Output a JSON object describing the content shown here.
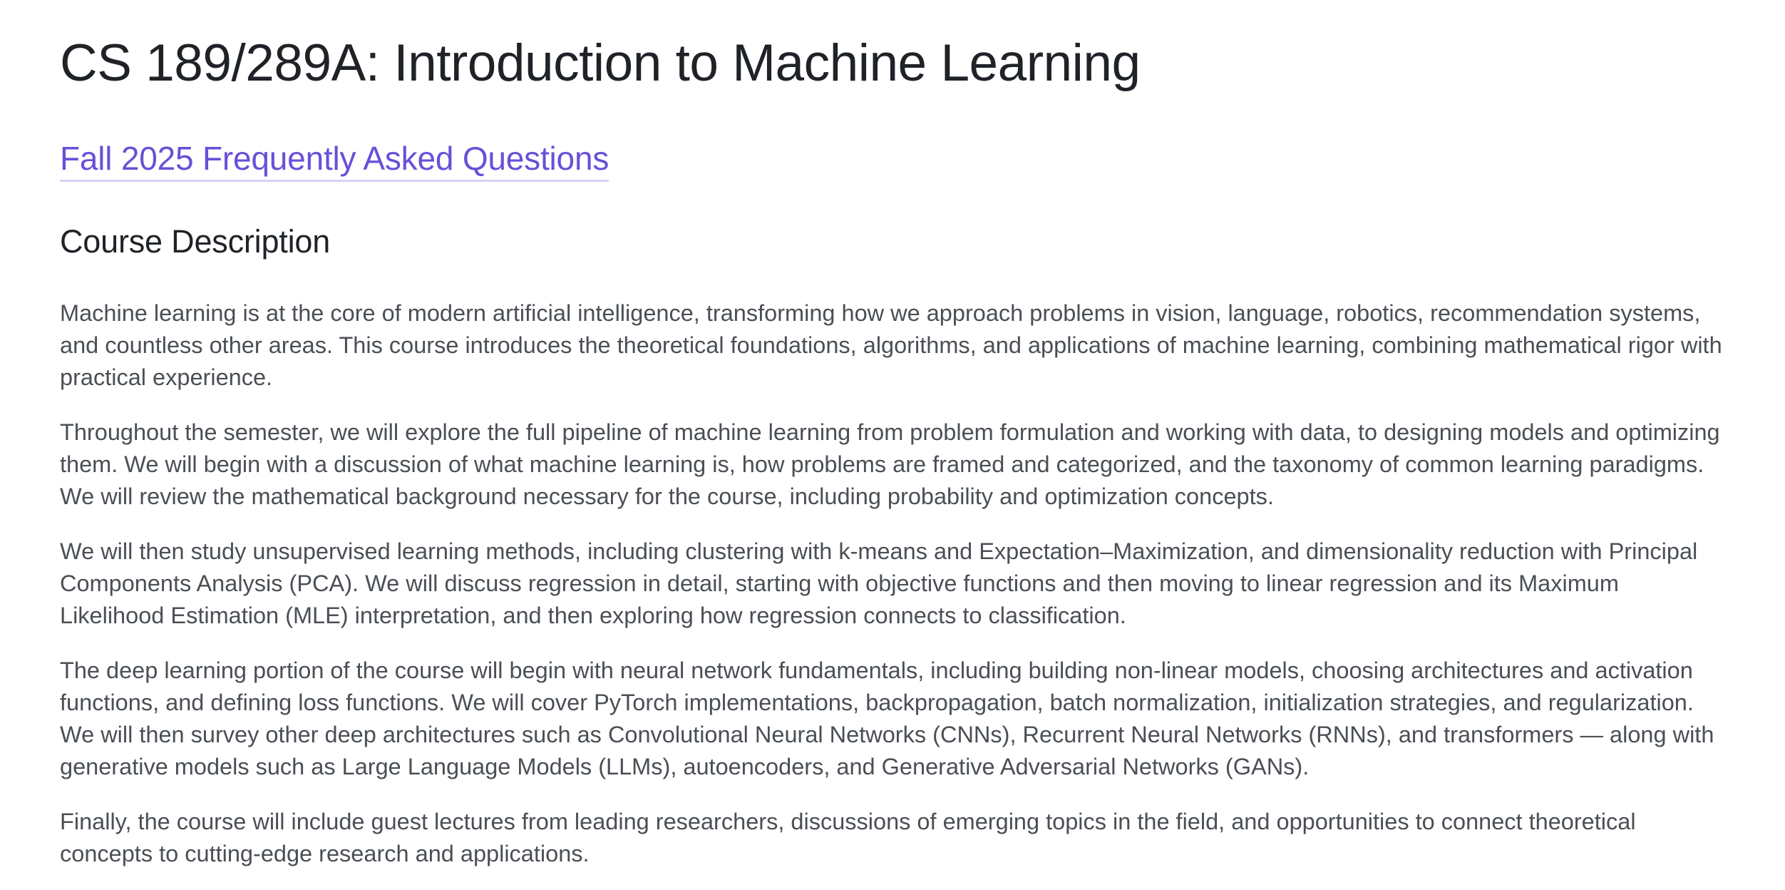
{
  "page": {
    "title": "CS 189/289A: Introduction to Machine Learning",
    "faq_link": "Fall 2025 Frequently Asked Questions",
    "section_heading": "Course Description",
    "colors": {
      "link": "#6a4fd8",
      "heading": "#1f2328",
      "body_text": "#4a4f55"
    },
    "paragraphs": [
      "Machine learning is at the core of modern artificial intelligence, transforming how we approach problems in vision, language, robotics, recommendation systems, and countless other areas. This course introduces the theoretical foundations, algorithms, and applications of machine learning, combining mathematical rigor with practical experience.",
      "Throughout the semester, we will explore the full pipeline of machine learning from problem formulation and working with data, to designing models and optimizing them. We will begin with a discussion of what machine learning is, how problems are framed and categorized, and the taxonomy of common learning paradigms. We will review the mathematical background necessary for the course, including probability and optimization concepts.",
      "We will then study unsupervised learning methods, including clustering with k-means and Expectation–Maximization, and dimensionality reduction with Principal Components Analysis (PCA). We will discuss regression in detail, starting with objective functions and then moving to linear regression and its Maximum Likelihood Estimation (MLE) interpretation, and then exploring how regression connects to classification.",
      "The deep learning portion of the course will begin with neural network fundamentals, including building non-linear models, choosing architectures and activation functions, and defining loss functions. We will cover PyTorch implementations, backpropagation, batch normalization, initialization strategies, and regularization. We will then survey other deep architectures such as Convolutional Neural Networks (CNNs), Recurrent Neural Networks (RNNs), and transformers — along with generative models such as Large Language Models (LLMs), autoencoders, and Generative Adversarial Networks (GANs).",
      "Finally, the course will include guest lectures from leading researchers, discussions of emerging topics in the field, and opportunities to connect theoretical concepts to cutting-edge research and applications."
    ]
  }
}
